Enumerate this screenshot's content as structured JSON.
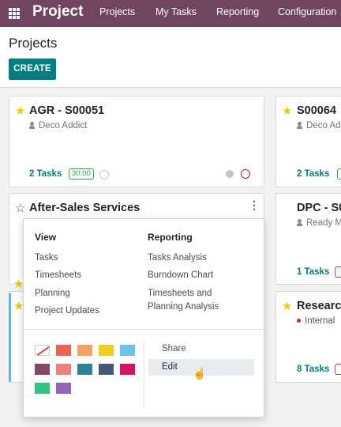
{
  "navbar": {
    "brand": "Project",
    "items": [
      "Projects",
      "My Tasks",
      "Reporting",
      "Configuration"
    ]
  },
  "control": {
    "title": "Projects",
    "create_label": "CREATE"
  },
  "cards": {
    "agr": {
      "title": "AGR - S00051",
      "customer": "Deco Addict",
      "tasks": "2 Tasks",
      "hours": "30:00",
      "favorite": true
    },
    "s64": {
      "title": "S00064",
      "customer": "Deco Ad",
      "tasks": "2 Tasks",
      "favorite": true
    },
    "after_sales": {
      "title": "After-Sales Services",
      "favorite": false
    },
    "dpc": {
      "title": "DPC - S0",
      "customer": "Ready M",
      "tasks": "1 Tasks"
    },
    "research": {
      "title": "Research",
      "tag": "Internal",
      "tasks": "8 Tasks",
      "favorite": true
    }
  },
  "dropdown": {
    "view_header": "View",
    "view_items": [
      "Tasks",
      "Timesheets",
      "Planning",
      "Project Updates"
    ],
    "reporting_header": "Reporting",
    "reporting_items": [
      "Tasks Analysis",
      "Burndown Chart",
      "Timesheets and",
      "Planning Analysis"
    ],
    "share_label": "Share",
    "edit_label": "Edit",
    "colors": [
      "#ffffff",
      "#ee6352",
      "#f4a261",
      "#f3cc20",
      "#6ec1ea",
      "#814968",
      "#f08080",
      "#2c8397",
      "#475577",
      "#d6145f",
      "#30c381",
      "#9365b8"
    ]
  },
  "accent": {
    "brand": "#71445f",
    "primary": "#017e84",
    "star": "#f3cc00"
  }
}
